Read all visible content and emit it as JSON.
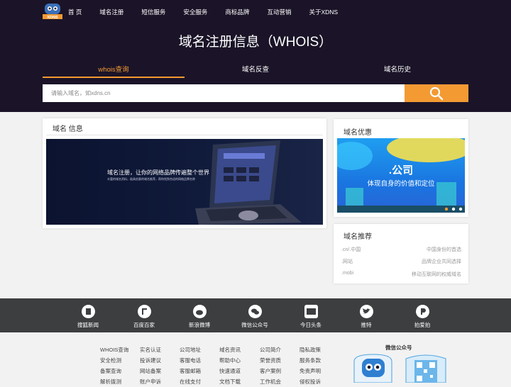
{
  "nav": {
    "items": [
      "首 页",
      "域名注册",
      "短信服务",
      "安全服务",
      "商标品牌",
      "互动营销",
      "关于XDNS"
    ]
  },
  "logo": {
    "text": "XDNS"
  },
  "page_title": "域名注册信息（WHOIS）",
  "tabs": [
    {
      "label": "whois查询",
      "active": true
    },
    {
      "label": "域名反查",
      "active": false
    },
    {
      "label": "域名历史",
      "active": false
    }
  ],
  "search": {
    "placeholder": "请输入域名，如xdns.cn",
    "value": ""
  },
  "info_card": {
    "heading": "域名   信息",
    "banner_title": "域名注册，让你的网络品牌传遍整个世界",
    "banner_sub": "丰富的域名资料，极具创意的域名推荐，帮你找到合适的网络品牌名称"
  },
  "promo_card": {
    "heading": "域名优惠",
    "banner_title": ".公司",
    "banner_sub": "体现自身的价值和定位"
  },
  "recommend_card": {
    "heading": "域名推荐",
    "rows": [
      {
        "name": ".cn/.中国",
        "desc": "中国身份的首选"
      },
      {
        "name": ".网站",
        "desc": "品牌企业共同选择"
      },
      {
        "name": ".mobi",
        "desc": "移动互联网的权威域名"
      }
    ]
  },
  "social": [
    {
      "label": "搜狐新闻",
      "icon": "sohu-news-icon"
    },
    {
      "label": "百度百家",
      "icon": "baidu-baijia-icon"
    },
    {
      "label": "新浪微博",
      "icon": "weibo-icon"
    },
    {
      "label": "微信公众号",
      "icon": "wechat-icon"
    },
    {
      "label": "今日头条",
      "icon": "toutiao-icon"
    },
    {
      "label": "推特",
      "icon": "twitter-icon"
    },
    {
      "label": "拍爱拍",
      "icon": "paipai-icon"
    }
  ],
  "footer_links": [
    [
      "WHOIS查询",
      "安全检测",
      "备案查询",
      "解析拨测"
    ],
    [
      "实名认证",
      "投诉建议",
      "网站备案",
      "账户申诉"
    ],
    [
      "公司地址",
      "客服电话",
      "客服邮箱",
      "在线支付"
    ],
    [
      "域名资讯",
      "帮助中心",
      "快速通道",
      "文档下载"
    ],
    [
      "公司简介",
      "荣誉资质",
      "客户案例",
      "工作机会"
    ],
    [
      "隐私政策",
      "服务条款",
      "免责声明",
      "侵权投诉"
    ]
  ],
  "wechat": {
    "title": "微信公众号"
  },
  "colors": {
    "accent": "#f39a33",
    "hero_bg": "#1b1428",
    "footer_bar": "#3c3e40"
  }
}
